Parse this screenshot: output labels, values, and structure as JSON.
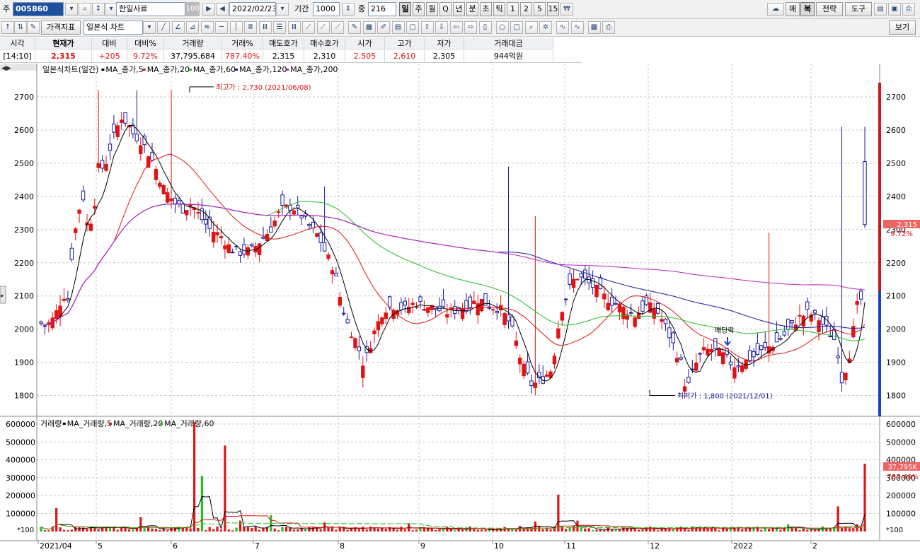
{
  "toolbar": {
    "market_label": "주",
    "stock_code": "005860",
    "stock_name": "한일사료",
    "name_suffix": "100",
    "date": "2022/02/23",
    "period_label": "기간",
    "period_value": "1000",
    "count_label": "중",
    "count_value": "216",
    "intervals": [
      "일",
      "주",
      "월",
      "Q",
      "년",
      "분",
      "초",
      "틱",
      "1",
      "2",
      "5",
      "15"
    ],
    "selected_interval": "일",
    "right_buttons": [
      "매",
      "복",
      "전략",
      "도구"
    ],
    "indicator_button": "가격지표",
    "chart_type": "일본식 차트",
    "view_button": "보기"
  },
  "quote": {
    "headers": [
      "시각",
      "현재가",
      "대비",
      "대비%",
      "거래량",
      "거래%",
      "매도호가",
      "매수호가",
      "시가",
      "고가",
      "저가",
      "거래대금"
    ],
    "values": [
      "[14:10]",
      "2,315",
      "+205",
      "9.72%",
      "37,795,684",
      "787.40%",
      "2,315",
      "2,310",
      "2,505",
      "2,610",
      "2,305",
      "944억원"
    ]
  },
  "price_panel": {
    "title": "일본식차트(일간)",
    "ma_legend": [
      {
        "label": "MA_종가,5",
        "color": "#000000"
      },
      {
        "label": "MA_종가,20",
        "color": "#e01414"
      },
      {
        "label": "MA_종가,60",
        "color": "#22c022"
      },
      {
        "label": "MA_종가,120",
        "color": "#1a1aa0"
      },
      {
        "label": "MA_종가,200",
        "color": "#c020c0"
      }
    ],
    "y_ticks": [
      "2700",
      "2600",
      "2500",
      "2400",
      "2300",
      "2200",
      "2100",
      "2000",
      "1900",
      "1800"
    ],
    "high_note": "최고가 : 2,730 (2021/06/08)",
    "low_note": "최저가 : 1,800 (2021/12/01)",
    "dividend_note": "배당락",
    "current_price_tag": "2,315",
    "current_pct_tag": "9.72%"
  },
  "volume_panel": {
    "title": "거래량",
    "ma_legend": [
      {
        "label": "MA_거래량,5",
        "color": "#000000"
      },
      {
        "label": "MA_거래량,20",
        "color": "#e01414"
      },
      {
        "label": "MA_거래량,60",
        "color": "#22c022"
      }
    ],
    "y_ticks": [
      "600000",
      "500000",
      "400000",
      "300000",
      "200000",
      "100000"
    ],
    "unit_label": "*100",
    "current_volume_tag": "37,795K",
    "current_pct_tag": "787.40%"
  },
  "x_axis": {
    "labels": [
      "2021/04",
      "5",
      "6",
      "7",
      "8",
      "9",
      "10",
      "11",
      "12",
      "2022",
      "2"
    ]
  },
  "colors": {
    "up": "#e01414",
    "down": "#1a1aa0",
    "grid": "#c8c8c8",
    "ma5": "#000000",
    "ma20": "#e01414",
    "ma60": "#22c022",
    "ma120": "#1a1aa0",
    "ma200": "#c020c0"
  }
}
